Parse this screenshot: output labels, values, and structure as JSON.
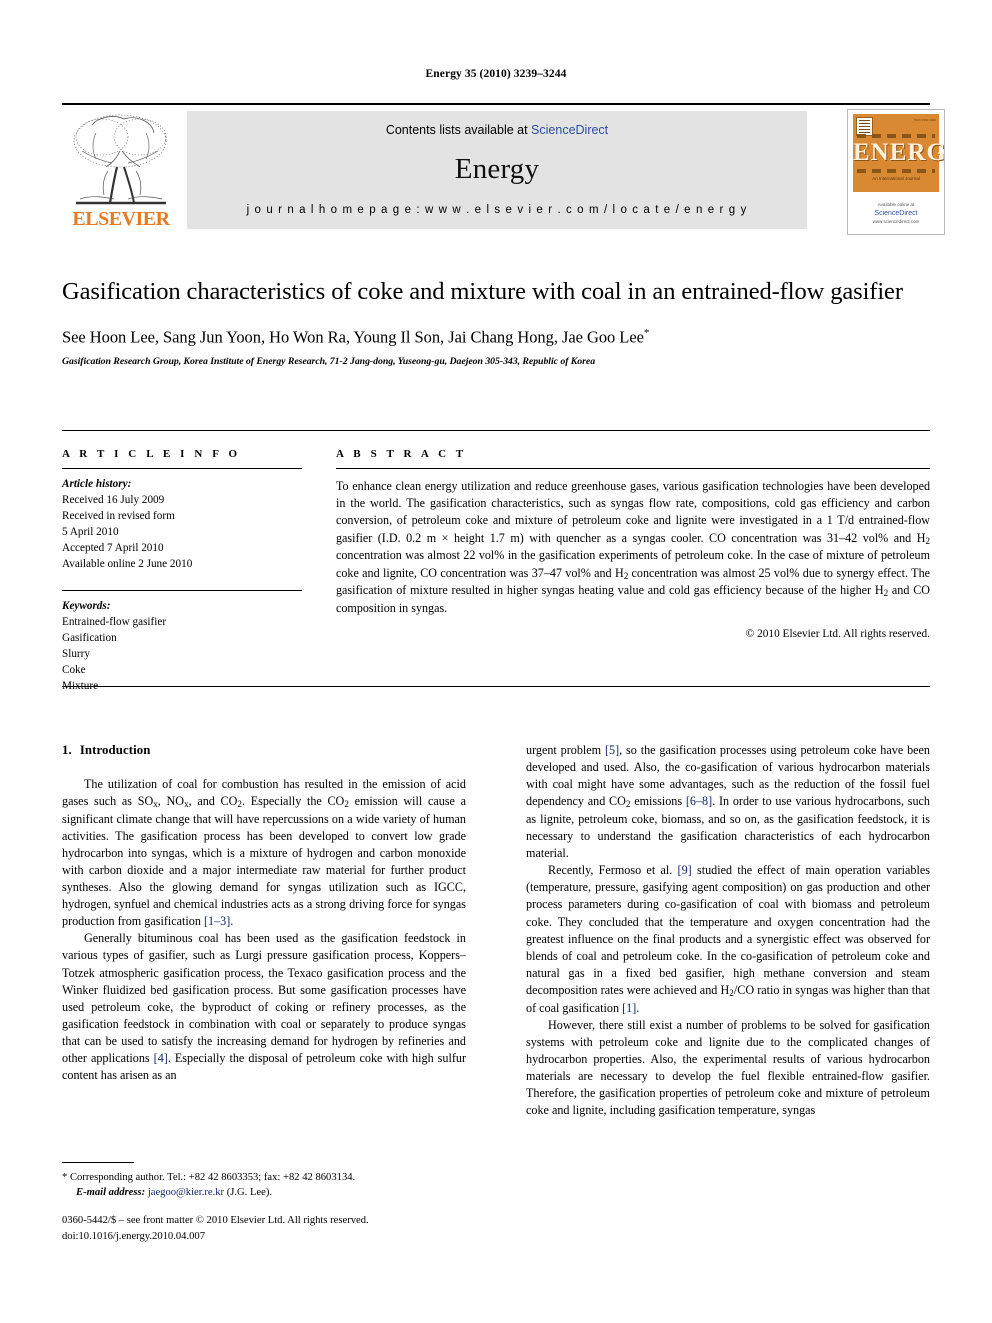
{
  "running_head": "Energy 35 (2010) 3239–3244",
  "masthead": {
    "publisher_name": "ELSEVIER",
    "contents_prefix": "Contents lists available at ",
    "contents_link": "ScienceDirect",
    "journal_name": "Energy",
    "homepage": "j o u r n a l   h o m e p a g e :   w w w . e l s e v i e r . c o m / l o c a t e / e n e r g y",
    "cover": {
      "wordmark": "ENERGY",
      "tagline": "An International Journal",
      "available_line": "Available online at",
      "sciencedirect": "ScienceDirect",
      "url": "www.sciencedirect.com",
      "issn_code": "ISSN 0360-5442"
    }
  },
  "title": "Gasification characteristics of coke and mixture with coal in an entrained-flow gasifier",
  "authors": "See Hoon Lee, Sang Jun Yoon, Ho Won Ra, Young Il Son, Jai Chang Hong, Jae Goo Lee",
  "author_star": "*",
  "affiliation": "Gasification Research Group, Korea Institute of Energy Research, 71-2 Jang-dong, Yuseong-gu, Daejeon 305-343, Republic of Korea",
  "article_info": {
    "heading": "A R T I C L E   I N F O",
    "history_label": "Article history:",
    "history": [
      "Received 16 July 2009",
      "Received in revised form",
      "5 April 2010",
      "Accepted 7 April 2010",
      "Available online 2 June 2010"
    ],
    "keywords_label": "Keywords:",
    "keywords": [
      "Entrained-flow gasifier",
      "Gasification",
      "Slurry",
      "Coke",
      "Mixture"
    ]
  },
  "abstract": {
    "heading": "A B S T R A C T",
    "part1": "To enhance clean energy utilization and reduce greenhouse gases, various gasification technologies have been developed in the world. The gasification characteristics, such as syngas flow rate, compositions, cold gas efficiency and carbon conversion, of petroleum coke and mixture of petroleum coke and lignite were investigated in a 1 T/d entrained-flow gasifier (I.D. 0.2 m × height 1.7 m) with quencher as a syngas cooler. CO concentration was 31–42 vol% and H",
    "sub1": "2",
    "part2": " concentration was almost 22 vol% in the gasification experiments of petroleum coke. In the case of mixture of petroleum coke and lignite, CO concentration was 37–47 vol% and H",
    "sub2": "2",
    "part3": " concentration was almost 25 vol% due to synergy effect. The gasification of mixture resulted in higher syngas heating value and cold gas efficiency because of the higher H",
    "sub3": "2",
    "part4": " and CO composition in syngas.",
    "copyright": "© 2010 Elsevier Ltd. All rights reserved."
  },
  "body": {
    "section_number": "1.",
    "section_title": "Introduction",
    "left": {
      "p1_a": "The utilization of coal for combustion has resulted in the emission of acid gases such as SO",
      "p1_sub_x1": "x",
      "p1_b": ", NO",
      "p1_sub_x2": "x",
      "p1_c": ", and CO",
      "p1_sub_2a": "2",
      "p1_d": ". Especially the CO",
      "p1_sub_2b": "2",
      "p1_e": " emission will cause a significant climate change that will have repercussions on a wide variety of human activities. The gasification process has been developed to convert low grade hydrocarbon into syngas, which is a mixture of hydrogen and carbon monoxide with carbon dioxide and a major intermediate raw material for further product syntheses. Also the glowing demand for syngas utilization such as IGCC, hydrogen, synfuel and chemical industries acts as a strong driving force for syngas production from gasification ",
      "p1_ref": "[1–3]",
      "p1_end": ".",
      "p2_a": "Generally bituminous coal has been used as the gasification feedstock in various types of gasifier, such as Lurgi pressure gasification process, Koppers–Totzek atmospheric gasification process, the Texaco gasification process and the Winker fluidized bed gasification process. But some gasification processes have used petroleum coke, the byproduct of coking or refinery processes, as the gasification feedstock in combination with coal or separately to produce syngas that can be used to satisfy the increasing demand for hydrogen by refineries and other applications ",
      "p2_ref": "[4]",
      "p2_b": ". Especially the disposal of petroleum coke with high sulfur content has arisen as an"
    },
    "right": {
      "p3_a": "urgent problem ",
      "p3_ref1": "[5]",
      "p3_b": ", so the gasification processes using petroleum coke have been developed and used. Also, the co-gasification of various hydrocarbon materials with coal might have some advantages, such as the reduction of the fossil fuel dependency and CO",
      "p3_sub2": "2",
      "p3_c": " emissions ",
      "p3_ref2": "[6–8]",
      "p3_d": ". In order to use various hydrocarbons, such as lignite, petroleum coke, biomass, and so on, as the gasification feedstock, it is necessary to understand the gasification characteristics of each hydrocarbon material.",
      "p4_a": "Recently, Fermoso et al. ",
      "p4_ref1": "[9]",
      "p4_b": " studied the effect of main operation variables (temperature, pressure, gasifying agent composition) on gas production and other process parameters during co-gasification of coal with biomass and petroleum coke. They concluded that the temperature and oxygen concentration had the greatest influence on the final products and a synergistic effect was observed for blends of coal and petroleum coke. In the co-gasification of petroleum coke and natural gas in a fixed bed gasifier, high methane conversion and steam decomposition rates were achieved and H",
      "p4_sub2": "2",
      "p4_c": "/CO ratio in syngas was higher than that of coal gasification ",
      "p4_ref2": "[1]",
      "p4_d": ".",
      "p5": "However, there still exist a number of problems to be solved for gasification systems with petroleum coke and lignite due to the complicated changes of hydrocarbon properties. Also, the experimental results of various hydrocarbon materials are necessary to develop the fuel flexible entrained-flow gasifier. Therefore, the gasification properties of petroleum coke and mixture of petroleum coke and lignite, including gasification temperature, syngas"
    }
  },
  "footnote": {
    "marker": "*",
    "text": " Corresponding author. Tel.: +82 42 8603353; fax: +82 42 8603134.",
    "email_label": "E-mail address:",
    "email": "jaegoo@kier.re.kr",
    "email_suffix": " (J.G. Lee)."
  },
  "footer": {
    "line1": "0360-5442/$ – see front matter © 2010 Elsevier Ltd. All rights reserved.",
    "line2": "doi:10.1016/j.energy.2010.04.007"
  },
  "colors": {
    "elsevier_orange": "#E87B22",
    "link_blue": "#2b4ea2",
    "reference_blue": "#12286b",
    "banner_gray": "#e3e3e3",
    "cover_orange": "#d98931"
  }
}
